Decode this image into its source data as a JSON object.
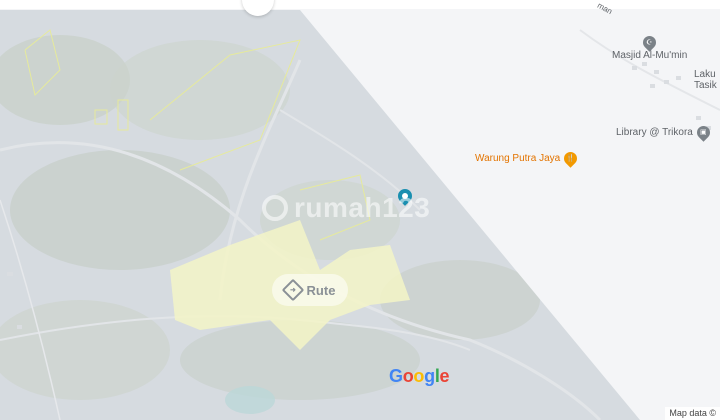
{
  "map": {
    "street_label": "man",
    "pois": [
      {
        "label": "Masjid Al-Mu'min",
        "icon": "mosque-icon",
        "color": "#7b8288"
      },
      {
        "label": "Laku Tasik D",
        "icon": "none",
        "color": "#7b8288"
      },
      {
        "label": "Library @ Trikora",
        "icon": "library-icon",
        "color": "#7b8288"
      },
      {
        "label": "Warung Putra Jaya",
        "icon": "restaurant-icon",
        "color": "#f29900"
      }
    ],
    "route_button": "Rute",
    "watermark": "rumah123",
    "google_logo": [
      "G",
      "o",
      "o",
      "g",
      "l",
      "e"
    ],
    "attribution": "Map data ©",
    "colors": {
      "satellite_overlay": "#d9dde2",
      "parcel_fill": "#f3f5c7",
      "marker": "#1a8fb0"
    }
  }
}
